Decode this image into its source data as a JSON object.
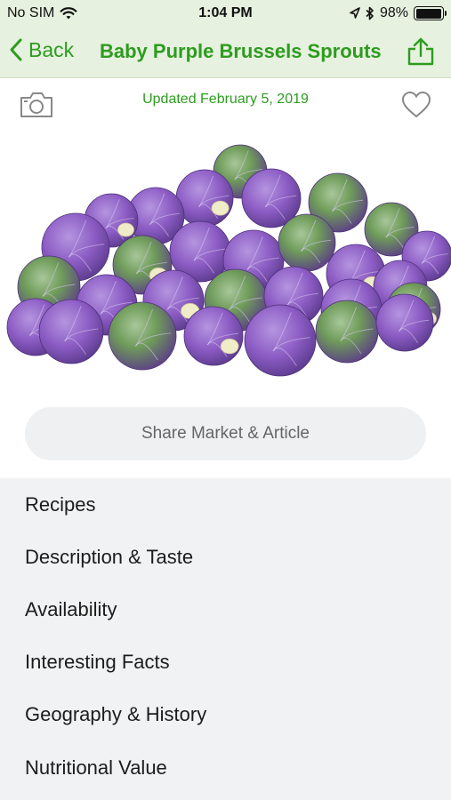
{
  "status": {
    "carrier": "No SIM",
    "time": "1:04 PM",
    "battery_percent": "98%",
    "battery_level": 0.98,
    "icons": [
      "wifi-icon",
      "location-arrow-icon",
      "bluetooth-icon",
      "battery-icon"
    ]
  },
  "nav": {
    "back_label": "Back",
    "title": "Baby Purple Brussels Sprouts",
    "icons": [
      "chevron-left-icon",
      "share-icon"
    ]
  },
  "meta": {
    "updated": "Updated February 5, 2019",
    "icons": [
      "camera-icon",
      "heart-icon"
    ]
  },
  "share_button": {
    "label": "Share Market & Article"
  },
  "menu": {
    "items": [
      {
        "label": "Recipes"
      },
      {
        "label": "Description & Taste"
      },
      {
        "label": "Availability"
      },
      {
        "label": "Interesting Facts"
      },
      {
        "label": "Geography & History"
      },
      {
        "label": "Nutritional Value"
      }
    ]
  },
  "colors": {
    "accent_green": "#2d9c1f",
    "header_background": "#e6f1df",
    "menu_background": "#f1f2f4",
    "sprout_purple": "#8c5cc4",
    "sprout_green": "#6f9c5a"
  }
}
